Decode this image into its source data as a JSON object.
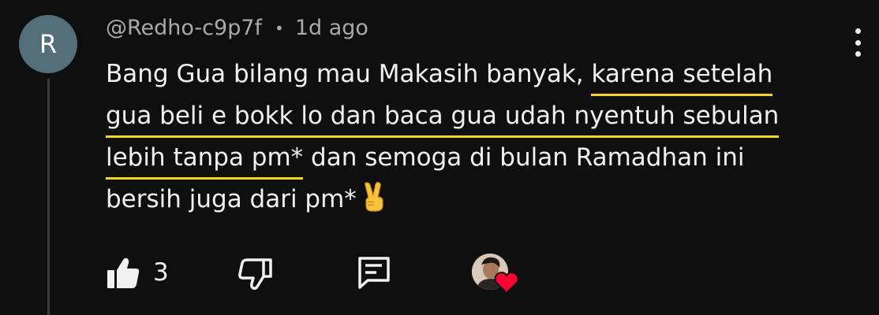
{
  "comment": {
    "author_initial": "R",
    "author": "@Redho-c9p7f",
    "separator": "•",
    "time": "1d ago",
    "lines": [
      {
        "plain": "Bang Gua bilang mau Makasih banyak, ",
        "highlight": "karena setelah",
        "rest": ""
      },
      {
        "plain": "",
        "highlight": "gua beli e bokk lo dan baca gua udah nyentuh sebulan",
        "rest": ""
      },
      {
        "plain": "",
        "highlight": "lebih tanpa pm*",
        "rest": " dan semoga di bulan Ramadhan ini"
      },
      {
        "plain": "bersih juga dari pm*",
        "highlight": "",
        "rest": ""
      }
    ],
    "emoji": "victory-hand-emoji"
  },
  "actions": {
    "like_count": "3",
    "like_icon": "thumbs-up-icon",
    "dislike_icon": "thumbs-down-icon",
    "reply_icon": "comment-reply-icon",
    "creator_heart": "creator-heart-badge"
  },
  "colors": {
    "background": "#0f0f0f",
    "text": "#f1f1f1",
    "muted": "#aaaaaa",
    "avatar": "#546e7a",
    "highlight_underline": "#f2d51f",
    "heart": "#ff0033"
  }
}
